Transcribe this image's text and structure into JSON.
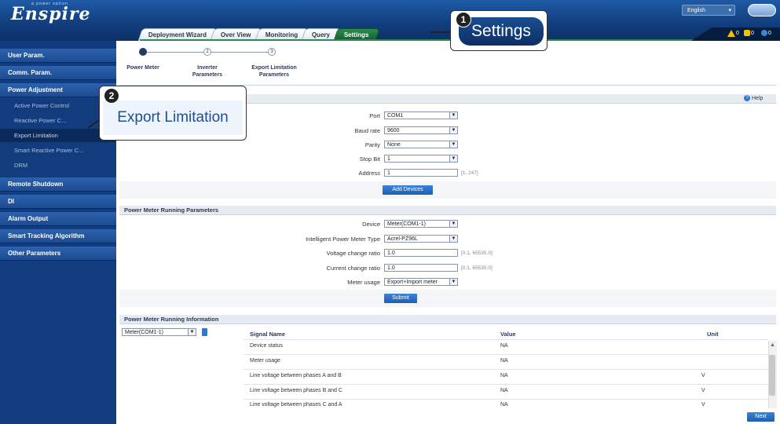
{
  "app": {
    "logo": "Enspire",
    "logo_tagline": "a power option"
  },
  "header": {
    "tabs": [
      "Deployment Wizard",
      "Over View",
      "Monitoring",
      "Query",
      "Settings"
    ],
    "active_tab": "Settings",
    "language": "English",
    "alarms": [
      {
        "type": "major",
        "color": "#f2c200",
        "count": "0"
      },
      {
        "type": "minor",
        "color": "#f2c200",
        "count": "0"
      },
      {
        "type": "warning",
        "color": "#3d86d9",
        "count": "0"
      }
    ]
  },
  "sidebar": {
    "items": [
      {
        "label": "User Param."
      },
      {
        "label": "Comm. Param."
      },
      {
        "label": "Power Adjustment"
      },
      {
        "label": "Remote Shutdown"
      },
      {
        "label": "DI"
      },
      {
        "label": "Alarm Output"
      },
      {
        "label": "Smart Tracking Algorithm"
      },
      {
        "label": "Other Parameters"
      }
    ],
    "sub_items": [
      {
        "label": "Active Power Control"
      },
      {
        "label": "Reactive Power C..."
      },
      {
        "label": "Export Limitation"
      },
      {
        "label": "Smart Reactive Power C..."
      },
      {
        "label": "DRM"
      }
    ]
  },
  "steps": [
    {
      "label": "Power Meter",
      "num": ""
    },
    {
      "label": "Inverter Parameters",
      "num": "2"
    },
    {
      "label": "Export Limitation Parameters",
      "num": "3"
    }
  ],
  "help": "Help",
  "port_section": {
    "fields": [
      {
        "label": "Port",
        "value": "COM1"
      },
      {
        "label": "Baud rate",
        "value": "9600"
      },
      {
        "label": "Parity",
        "value": "None"
      },
      {
        "label": "Stop Bit",
        "value": "1"
      },
      {
        "label": "Address",
        "value": "1",
        "hint": "[1, 247]"
      }
    ],
    "add_button": "Add Devices"
  },
  "running_params": {
    "title": "Power Meter Running Parameters",
    "device_label": "Device",
    "device_value": "Meter(COM1-1)",
    "type_label": "Intelligent Power Meter Type",
    "type_value": "Acrel-PZ96L",
    "voltage_label": "Voltage change ratio",
    "voltage_value": "1.0",
    "voltage_hint": "[0.1, 65535.0]",
    "current_label": "Current change ratio",
    "current_value": "1.0",
    "current_hint": "[0.1, 65535.0]",
    "usage_label": "Meter usage",
    "usage_value": "Export+Import meter",
    "submit": "Submit"
  },
  "running_info": {
    "title": "Power Meter Running Information",
    "device_select": "Meter(COM1-1)",
    "columns": [
      "Signal Name",
      "Value",
      "Unit"
    ],
    "rows": [
      {
        "name": "Device status",
        "value": "NA",
        "unit": ""
      },
      {
        "name": "Meter usage",
        "value": "NA",
        "unit": ""
      },
      {
        "name": "Line voltage between phases A and B",
        "value": "NA",
        "unit": "V"
      },
      {
        "name": "Line voltage between phases B and C",
        "value": "NA",
        "unit": "V"
      },
      {
        "name": "Line voltage between phases C and A",
        "value": "NA",
        "unit": "V"
      }
    ]
  },
  "next_button": "Next",
  "callouts": [
    {
      "num": "1",
      "text": "Settings"
    },
    {
      "num": "2",
      "text": "Export Limitation"
    }
  ]
}
